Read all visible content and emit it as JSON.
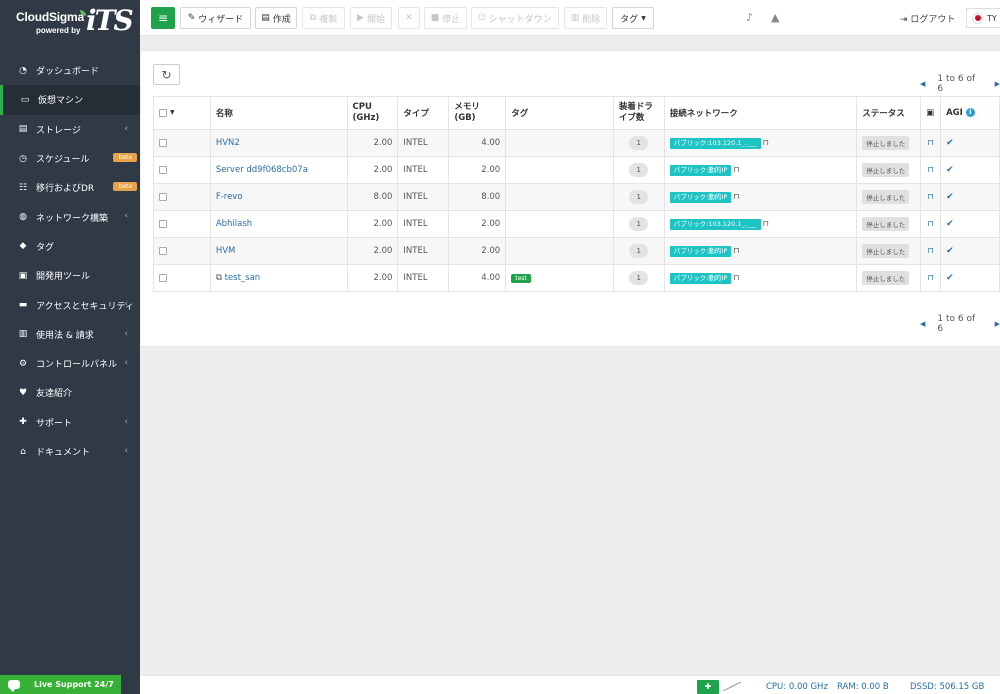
{
  "brand": {
    "name": "CloudSigma",
    "sub": "powered by",
    "mark": "iTS"
  },
  "sidebar": {
    "items": [
      {
        "label": "ダッシュボード",
        "icon": "dashboard-icon",
        "glyph": "◔",
        "chevron": false
      },
      {
        "label": "仮想マシン",
        "icon": "monitor-icon",
        "glyph": "▭",
        "chevron": false,
        "active": true
      },
      {
        "label": "ストレージ",
        "icon": "storage-icon",
        "glyph": "▤",
        "chevron": true
      },
      {
        "label": "スケジュール",
        "icon": "clock-icon",
        "glyph": "◷",
        "badge": "beta"
      },
      {
        "label": "移行およびDR",
        "icon": "server-icon",
        "glyph": "☷",
        "badge": "beta"
      },
      {
        "label": "ネットワーク構築",
        "icon": "globe-icon",
        "glyph": "◍",
        "chevron": true
      },
      {
        "label": "タグ",
        "icon": "tags-icon",
        "glyph": "◆",
        "chevron": false
      },
      {
        "label": "開発用ツール",
        "icon": "terminal-icon",
        "glyph": "▣",
        "chevron": false
      },
      {
        "label": "アクセスとセキュリティ",
        "icon": "lock-icon",
        "glyph": "▬",
        "chevron": true
      },
      {
        "label": "使用法 & 請求",
        "icon": "bar-chart-icon",
        "glyph": "▥",
        "chevron": true
      },
      {
        "label": "コントロールパネル",
        "icon": "cogs-icon",
        "glyph": "⚙",
        "chevron": true
      },
      {
        "label": "友達紹介",
        "icon": "heart-icon",
        "glyph": "♥",
        "chevron": false
      },
      {
        "label": "サポート",
        "icon": "support-icon",
        "glyph": "✚",
        "chevron": true
      },
      {
        "label": "ドキュメント",
        "icon": "bank-icon",
        "glyph": "⌂",
        "chevron": true
      }
    ],
    "chevron_glyph": "‹",
    "live_support": "Live Support 24/7"
  },
  "toolbar": {
    "menu_glyph": "≡",
    "wizard": "ウィザード",
    "create": "作成",
    "clone": "複製",
    "start": "開始",
    "stop": "停止",
    "shutdown": "シャットダウン",
    "delete": "削除",
    "tags": "タグ",
    "logout": "ログアウト",
    "lang": "TY"
  },
  "pager": {
    "text": "1 to 6 of 6",
    "prev": "◀",
    "next": "▶"
  },
  "table": {
    "headers": {
      "name": "名称",
      "cpu": "CPU",
      "cpu_unit": "(GHz)",
      "type": "タイプ",
      "mem": "メモリ",
      "mem_unit": "(GB)",
      "tag": "タグ",
      "drives": "装着ドラ",
      "drives2": "イブ数",
      "network": "接続ネットワーク",
      "status": "ステータス",
      "agi": "AGI",
      "info": "i"
    },
    "rows": [
      {
        "name": "HVN2",
        "cpu": "2.00",
        "type": "INTEL",
        "mem": "4.00",
        "tag": "",
        "drives": "1",
        "network": "パブリック:103.120.1_.___",
        "status": "停止しました",
        "link": false
      },
      {
        "name": "Server dd9f068cb07a",
        "cpu": "2.00",
        "type": "INTEL",
        "mem": "2.00",
        "tag": "",
        "drives": "1",
        "network": "パブリック:動的IP",
        "status": "停止しました",
        "link": false
      },
      {
        "name": "F-revo",
        "cpu": "8.00",
        "type": "INTEL",
        "mem": "8.00",
        "tag": "",
        "drives": "1",
        "network": "パブリック:動的IP",
        "status": "停止しました",
        "link": false
      },
      {
        "name": "Abhilash",
        "cpu": "2.00",
        "type": "INTEL",
        "mem": "2.00",
        "tag": "",
        "drives": "1",
        "network": "パブリック:103.120.1_.___",
        "status": "停止しました",
        "link": false
      },
      {
        "name": "HVM",
        "cpu": "2.00",
        "type": "INTEL",
        "mem": "2.00",
        "tag": "",
        "drives": "1",
        "network": "パブリック:動的IP",
        "status": "停止しました",
        "link": false
      },
      {
        "name": "test_san",
        "cpu": "2.00",
        "type": "INTEL",
        "mem": "4.00",
        "tag": "test",
        "drives": "1",
        "network": "パブリック:動的IP",
        "status": "停止しました",
        "link": true
      }
    ]
  },
  "footer": {
    "cpu": "CPU: 0.00 GHz",
    "ram": "RAM: 0.00 B",
    "dssd": "DSSD: 506.15 GB"
  },
  "colors": {
    "sidebar": "#2f3a46",
    "accent": "#1fa34a",
    "link": "#2a6ea6",
    "network": "#1ec4c4"
  }
}
